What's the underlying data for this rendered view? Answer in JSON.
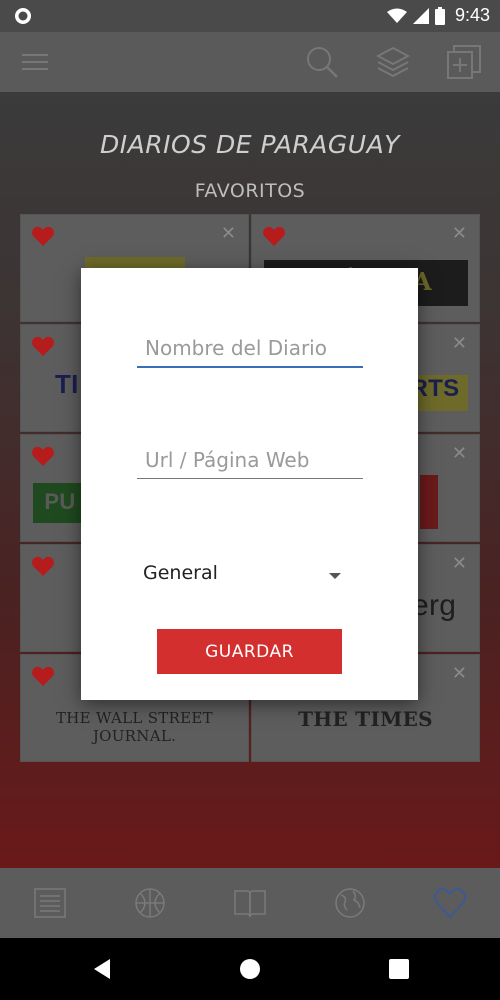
{
  "status_bar": {
    "time": "9:43"
  },
  "content": {
    "title": "DIARIOS DE PARAGUAY",
    "subtitle": "FAVORITOS",
    "cards": [
      {
        "logo": ""
      },
      {
        "logo": "CRÓNICA"
      },
      {
        "logo": "TI"
      },
      {
        "logo": "RTS"
      },
      {
        "logo": "PU"
      },
      {
        "logo": ""
      },
      {
        "logo": ""
      },
      {
        "logo": "erg"
      },
      {
        "logo": "THE WALL STREET JOURNAL."
      },
      {
        "logo": "THE TIMES"
      }
    ]
  },
  "dialog": {
    "name_placeholder": "Nombre del Diario",
    "url_placeholder": "Url / Página Web",
    "category_selected": "General",
    "save_label": "GUARDAR"
  },
  "colors": {
    "accent_red": "#d32f2f",
    "focus_blue": "#3a6fb5",
    "heart_red": "#b71c1c",
    "fav_blue": "#3b5998"
  }
}
